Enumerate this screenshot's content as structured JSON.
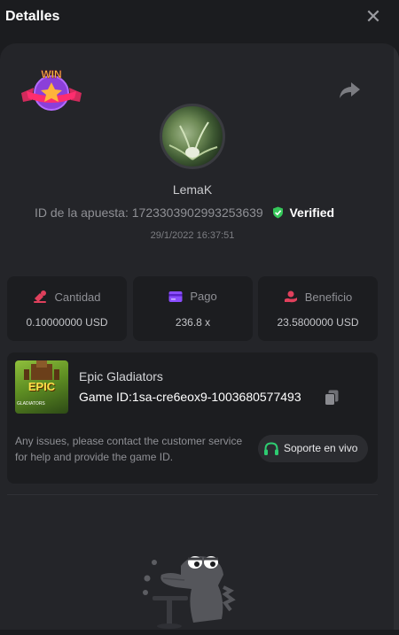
{
  "header": {
    "title": "Detalles"
  },
  "bet": {
    "username": "LemaK",
    "id_label": "ID de la apuesta:",
    "id_value": "1723303902993253639",
    "verified": "Verified",
    "date": "29/1/2022 16:37:51",
    "badge_text": "WIN"
  },
  "stats": [
    {
      "label": "Cantidad",
      "value": "0.10000000 USD",
      "icon": "coins-icon",
      "color": "#e0405c"
    },
    {
      "label": "Pago",
      "value": "236.8 x",
      "icon": "card-icon",
      "color": "#8a4dff"
    },
    {
      "label": "Beneficio",
      "value": "23.5800000 USD",
      "icon": "hand-coin-icon",
      "color": "#e0405c"
    }
  ],
  "game": {
    "name": "Epic Gladiators",
    "id_label": "Game ID:",
    "id_value": "1sa-cre6eox9-1003680577493",
    "thumb_title": "EPIC",
    "thumb_sub": "GLADIATORS",
    "issues_text": "Any issues, please contact the customer service for help and provide the game ID.",
    "support_label": "Soporte en vivo"
  },
  "colors": {
    "accent_green": "#2ecc71",
    "verified_green": "#35c759",
    "background": "#1b1c1f",
    "panel": "#242529"
  }
}
